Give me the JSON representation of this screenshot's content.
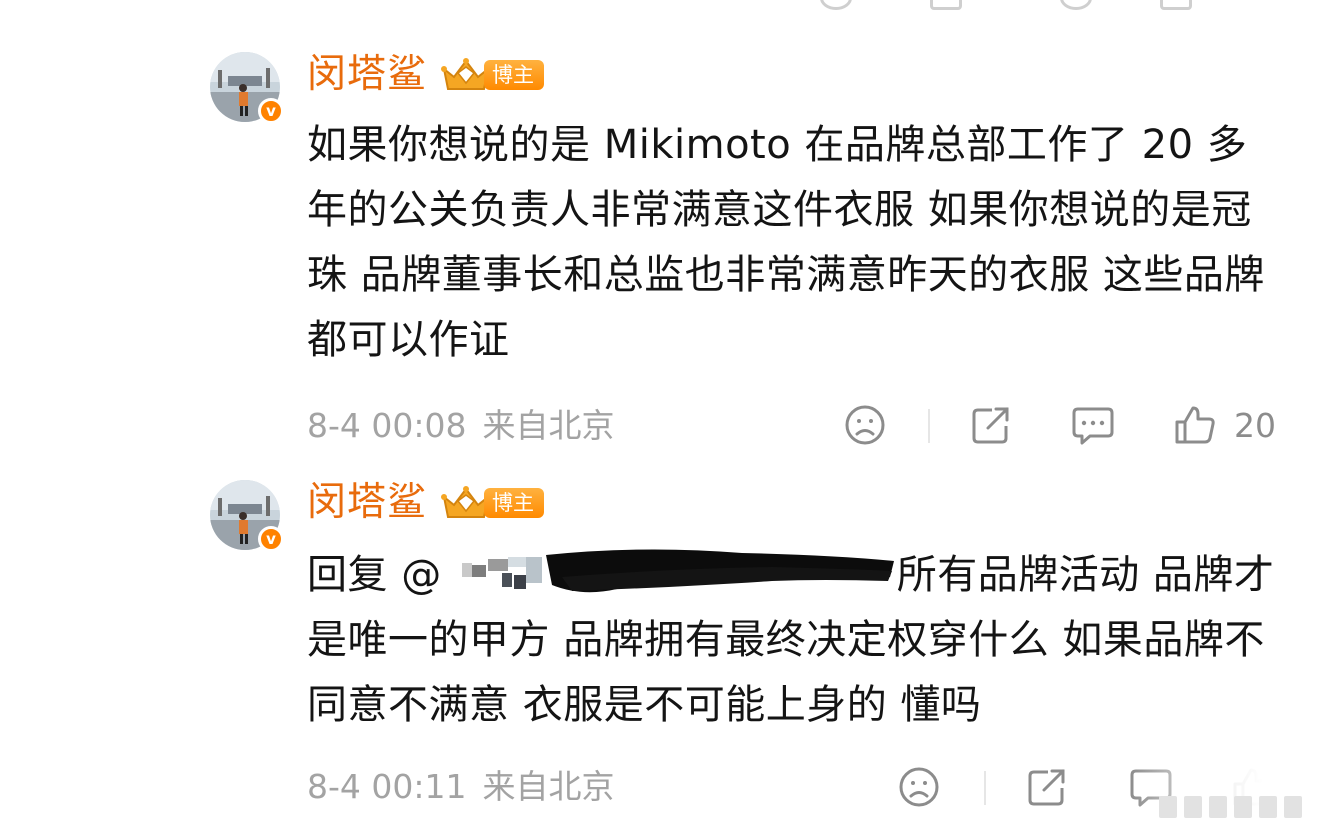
{
  "comments": [
    {
      "username": "闵塔鲨",
      "badge_label": "博主",
      "text": "如果你想说的是 Mikimoto 在品牌总部工作了 20 多年的公关负责人非常满意这件衣服 如果你想说的是冠珠 品牌董事长和总监也非常满意昨天的衣服 这些品牌都可以作证",
      "time": "8-4 00:08",
      "location": "来自北京",
      "like_count": "20"
    },
    {
      "username": "闵塔鲨",
      "badge_label": "博主",
      "reply_prefix": "回复 @",
      "text": "所有品牌活动 品牌才是唯一的甲方 品牌拥有最终决定权穿什么 如果品牌不同意不满意 衣服是不可能上身的 懂吗",
      "time": "8-4 00:11",
      "location": "来自北京"
    }
  ],
  "icons": {
    "dislike": "sad-face-icon",
    "share": "share-icon",
    "comment": "comment-icon",
    "like": "thumbs-up-icon",
    "verified": "verified-v-icon",
    "crown": "crown-badge-icon"
  },
  "colors": {
    "username": "#e86b0c",
    "badge": "#ff8a00",
    "meta": "#a3a3a3",
    "text": "#141414"
  }
}
